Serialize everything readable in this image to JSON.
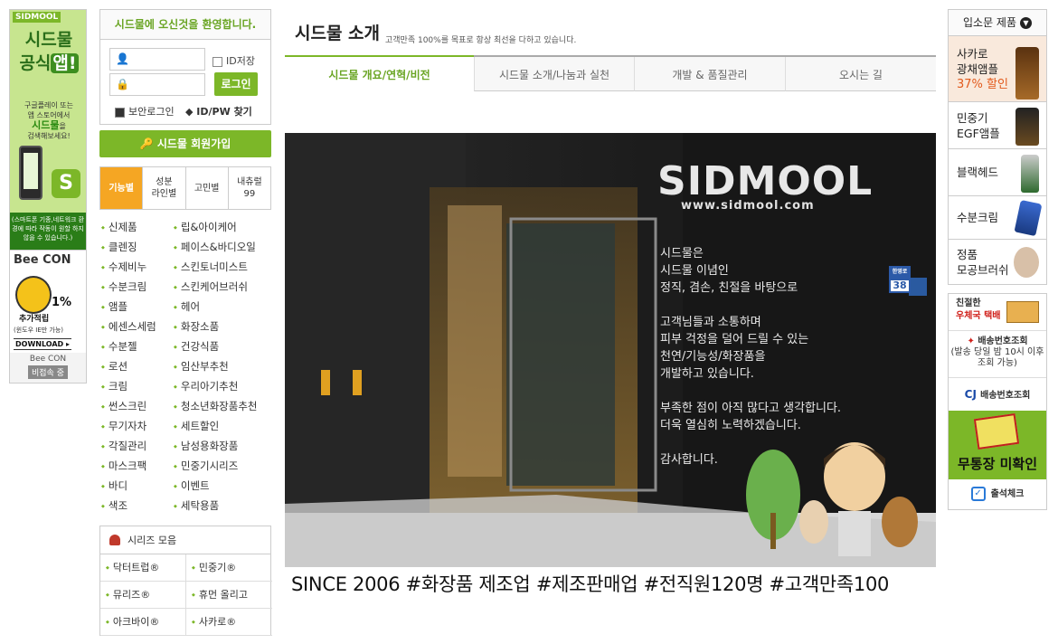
{
  "app_banner": {
    "brand": "SIDMOOL",
    "headline_1": "시드물",
    "headline_2": "공식",
    "headline_3": "앱!",
    "desc_1": "구글플레이 또는",
    "desc_2": "앱 스토어에서",
    "desc_3": "시드물",
    "desc_4": "을",
    "desc_5": "검색해보세요!",
    "notice": "(스마트폰 기종,네트워크 환경에 따라 작동이 원할 하지 않을 수 있습니다.)"
  },
  "beecon": {
    "title": "Bee CON",
    "percent": "1%",
    "extra": "추가적립",
    "windows": "(윈도우 IE만 가능)",
    "download": "DOWNLOAD ▸",
    "footer_name": "Bee CON",
    "footer_status": "비접속 중"
  },
  "login": {
    "welcome": "시드물에 오신것을 환영합니다.",
    "id_save": "ID저장",
    "login_button": "로그인",
    "secure_login": "보안로그인",
    "find": "ID/PW 찾기",
    "signup": "시드물 회원가입"
  },
  "category_tabs": [
    "기능별",
    "성분\n라인별",
    "고민별",
    "내츄럴\n99"
  ],
  "categories": [
    "신제품",
    "립&아이케어",
    "클렌징",
    "페이스&바디오일",
    "수제비누",
    "스킨토너미스트",
    "수분크림",
    "스킨케어브러쉬",
    "앰플",
    "헤어",
    "에센스세럼",
    "화장소품",
    "수분젤",
    "건강식품",
    "로션",
    "임산부추천",
    "크림",
    "우리아기추천",
    "썬스크린",
    "청소년화장품추천",
    "무기자차",
    "세트할인",
    "각질관리",
    "남성용화장품",
    "마스크팩",
    "민중기시리즈",
    "바디",
    "이벤트",
    "색조",
    "세탁용품"
  ],
  "series": {
    "title": "시리즈 모음",
    "items": [
      "닥터트럽®",
      "민중기®",
      "뮤리즈®",
      "휴먼 올리고",
      "아크바이®",
      "사카로®"
    ]
  },
  "main": {
    "title": "시드물 소개",
    "subtitle": "고객만족 100%를 목표로 항상 최선을 다하고 있습니다.",
    "tabs": [
      "시드물 개요/연혁/비전",
      "시드물 소개/나눔과 실천",
      "개발 & 품질관리",
      "오시는 길"
    ],
    "sign_brand": "SIDMOOL",
    "sign_url": "www.sidmool.com",
    "door_number": "38",
    "door_label": "한영로",
    "message": [
      "시드물은",
      "시드물 이념인",
      "정직, 겸손, 친절을 바탕으로",
      "",
      "고객님들과 소통하며",
      "피부 걱정을 덜어 드릴 수 있는",
      "천연/기능성/화장품을",
      "개발하고 있습니다.",
      "",
      "부족한 점이 아직 많다고 생각합니다.",
      "더욱 열심히 노력하겠습니다.",
      "",
      "감사합니다."
    ],
    "since": "SINCE 2006 #화장품 제조업 #제조판매업 #전직원120명 #고객만족100"
  },
  "right": {
    "header": "입소문 제품",
    "products": [
      {
        "line1": "사카로",
        "line2": "광채앰플",
        "line3": "37% 할인"
      },
      {
        "line1": "민중기",
        "line2": "EGF앰플",
        "line3": ""
      },
      {
        "line1": "블랙헤드",
        "line2": "",
        "line3": ""
      },
      {
        "line1": "수분크림",
        "line2": "",
        "line3": ""
      },
      {
        "line1": "정품",
        "line2": "모공브러쉬",
        "line3": ""
      }
    ],
    "post_1": "친절한",
    "post_2": "우체국 택배",
    "track_1": "배송번호조회",
    "track_1_note": "(발송 당일 밤 10시 이후 조회 가능)",
    "track_2": "배송번호조회",
    "deposit": "무통장 미확인",
    "attendance": "출석체크"
  },
  "colors": {
    "accent": "#7cb728",
    "orange": "#f5a623",
    "discount": "#e25a1c"
  }
}
